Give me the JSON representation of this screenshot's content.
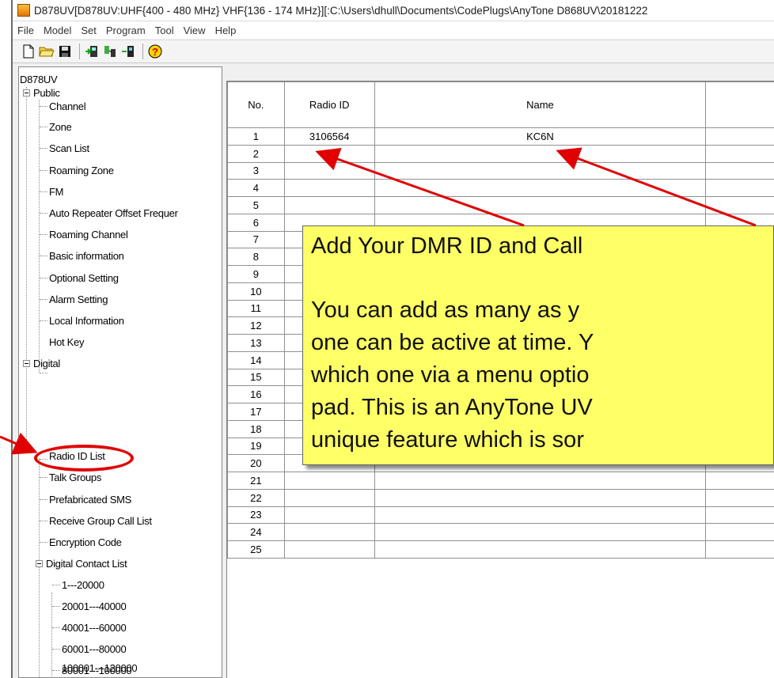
{
  "window": {
    "title": "D878UV[D878UV:UHF{400 - 480 MHz} VHF{136 - 174 MHz}][:C:\\Users\\dhull\\Documents\\CodePlugs\\AnyTone D868UV\\20181222"
  },
  "menu": [
    "File",
    "Model",
    "Set",
    "Program",
    "Tool",
    "View",
    "Help"
  ],
  "toolbar": {
    "icons": [
      "new-icon",
      "open-icon",
      "save-icon",
      "read-radio-icon",
      "write-radio-icon",
      "device-icon",
      "help-icon"
    ]
  },
  "tree": {
    "root": "D878UV",
    "public_label": "Public",
    "public_items": [
      "Channel",
      "Zone",
      "Scan List",
      "Roaming Zone",
      "FM",
      "Auto Repeater Offset Frequer",
      "Roaming Channel",
      "Basic information",
      "Optional Setting",
      "Alarm Setting",
      "Local Information",
      "Hot Key"
    ],
    "digital_label": "Digital",
    "digital_items": [
      "Radio ID List",
      "Talk Groups",
      "Prefabricated SMS",
      "Receive Group Call List",
      "Encryption Code"
    ],
    "contact_label": "Digital Contact List",
    "contact_items": [
      "1---20000",
      "20001---40000",
      "40001---60000",
      "60001---80000",
      "80001---100000",
      "100001---120000"
    ]
  },
  "grid": {
    "headers": {
      "no": "No.",
      "radio_id": "Radio ID",
      "name": "Name"
    },
    "rows": [
      {
        "no": "1",
        "radio_id": "3106564",
        "name": "KC6N"
      },
      {
        "no": "2",
        "radio_id": "",
        "name": ""
      },
      {
        "no": "3",
        "radio_id": "",
        "name": ""
      },
      {
        "no": "4",
        "radio_id": "",
        "name": ""
      },
      {
        "no": "5",
        "radio_id": "",
        "name": ""
      },
      {
        "no": "6",
        "radio_id": "",
        "name": ""
      },
      {
        "no": "7",
        "radio_id": "",
        "name": ""
      },
      {
        "no": "8",
        "radio_id": "",
        "name": ""
      },
      {
        "no": "9",
        "radio_id": "",
        "name": ""
      },
      {
        "no": "10",
        "radio_id": "",
        "name": ""
      },
      {
        "no": "11",
        "radio_id": "",
        "name": ""
      },
      {
        "no": "12",
        "radio_id": "",
        "name": ""
      },
      {
        "no": "13",
        "radio_id": "",
        "name": ""
      },
      {
        "no": "14",
        "radio_id": "",
        "name": ""
      },
      {
        "no": "15",
        "radio_id": "",
        "name": ""
      },
      {
        "no": "16",
        "radio_id": "",
        "name": ""
      },
      {
        "no": "17",
        "radio_id": "",
        "name": ""
      },
      {
        "no": "18",
        "radio_id": "",
        "name": ""
      },
      {
        "no": "19",
        "radio_id": "",
        "name": ""
      },
      {
        "no": "20",
        "radio_id": "",
        "name": ""
      },
      {
        "no": "21",
        "radio_id": "",
        "name": ""
      },
      {
        "no": "22",
        "radio_id": "",
        "name": ""
      },
      {
        "no": "23",
        "radio_id": "",
        "name": ""
      },
      {
        "no": "24",
        "radio_id": "",
        "name": ""
      },
      {
        "no": "25",
        "radio_id": "",
        "name": ""
      }
    ]
  },
  "callout": {
    "lines": [
      "Add Your DMR ID and Call",
      "You can add as many as y",
      "one can be active at time. Y",
      "which one via a menu optio",
      "pad. This is an AnyTone UV",
      "unique feature which is sor"
    ],
    "background": "#ffff66"
  },
  "annotation": {
    "color": "#e00000"
  }
}
